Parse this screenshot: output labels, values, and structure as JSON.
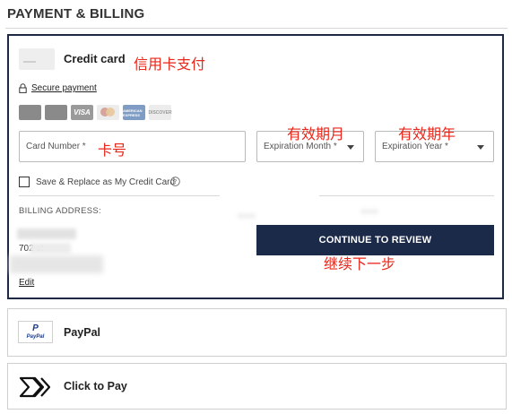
{
  "page": {
    "title": "PAYMENT & BILLING"
  },
  "credit_card": {
    "title": "Credit card",
    "annotation": "信用卡支付",
    "secure_payment": "Secure payment",
    "brands": [
      {
        "name": "generic-card-1",
        "label": ""
      },
      {
        "name": "generic-card-2",
        "label": ""
      },
      {
        "name": "visa",
        "label": "VISA"
      },
      {
        "name": "mastercard",
        "label": ""
      },
      {
        "name": "amex",
        "label": "AMERICAN EXPRESS"
      },
      {
        "name": "discover",
        "label": "DISCOVER"
      }
    ],
    "card_number_label": "Card Number *",
    "card_number_annotation": "卡号",
    "exp_month_label": "Expiration Month *",
    "exp_month_annotation": "有效期月",
    "exp_year_label": "Expiration Year *",
    "exp_year_annotation": "有效期年",
    "save_label": "Save & Replace as My Credit Card",
    "billing_address_heading": "BILLING ADDRESS:",
    "address_line_visible": "702    ct",
    "edit_label": "Edit",
    "continue_label": "CONTINUE TO REVIEW",
    "continue_annotation": "继续下一步"
  },
  "paypal": {
    "label": "PayPal",
    "logo_text": "PayPal"
  },
  "click_to_pay": {
    "label": "Click to Pay"
  },
  "colors": {
    "navy": "#1b2a48",
    "annotation_red": "#e8261a",
    "border_gray": "#cfcfcf"
  },
  "icons": [
    "lock-icon",
    "info-icon",
    "chevron-down-icon",
    "paypal-logo-icon",
    "click-to-pay-icon",
    "card-thumbnail-icon"
  ]
}
